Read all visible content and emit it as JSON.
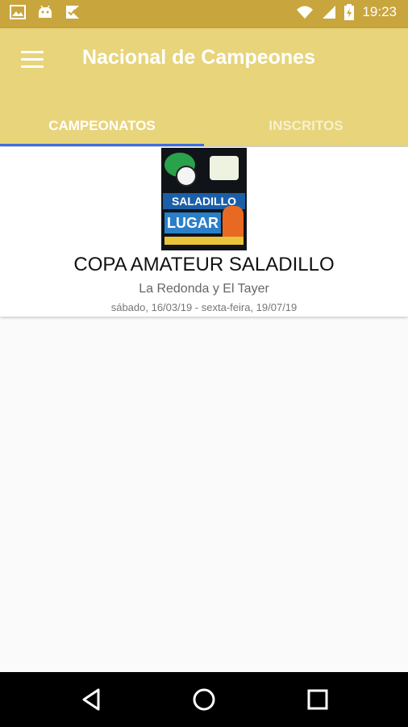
{
  "status_bar": {
    "time": "19:23",
    "bg_color": "#c9a53d",
    "left_icons": [
      "image-icon",
      "android-icon",
      "check-flag-icon"
    ],
    "right_icons": [
      "wifi-icon",
      "signal-icon",
      "battery-charging-icon"
    ]
  },
  "app_bar": {
    "title": "Nacional de Campeones",
    "bg_color": "#e8d47a"
  },
  "tabs": [
    {
      "label": "CAMPEONATOS",
      "active": true
    },
    {
      "label": "INSCRITOS",
      "active": false
    }
  ],
  "tab_indicator_color": "#3f6ee0",
  "championships": [
    {
      "title": "COPA AMATEUR SALADILLO",
      "venue": "La Redonda y El Tayer",
      "dates": "sábado, 16/03/19 - sexta-feira, 19/07/19",
      "poster": {
        "headline": "SALADILLO",
        "tagline": "LUGAR"
      }
    }
  ],
  "nav_bar": {
    "buttons": [
      "back-icon",
      "home-icon",
      "recents-icon"
    ]
  }
}
